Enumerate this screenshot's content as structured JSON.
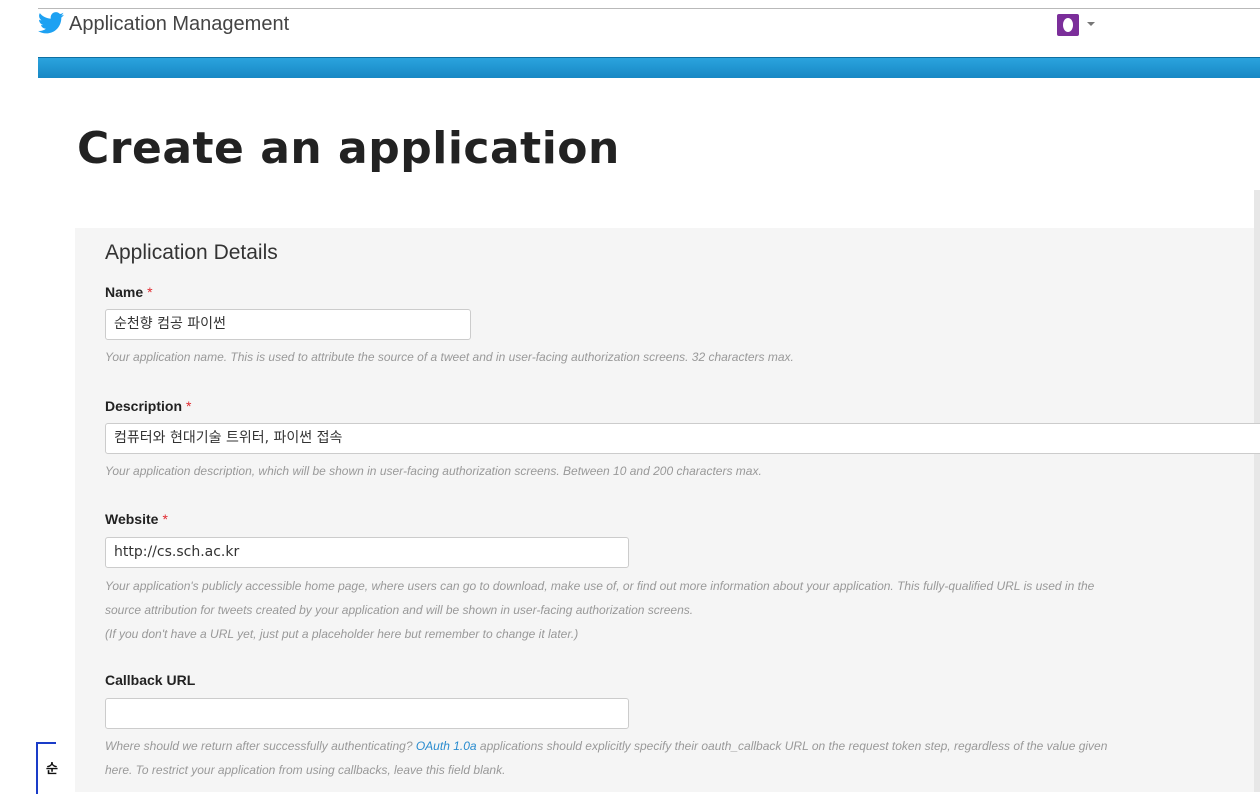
{
  "header": {
    "app_title": "Application Management",
    "logo_icon": "twitter-bird-icon",
    "brand_color": "#1da1f2",
    "avatar_icon": "user-avatar-icon",
    "menu_icon": "caret-down-icon"
  },
  "page": {
    "title": "Create an application"
  },
  "form": {
    "section_title": "Application Details",
    "required_marker": "*",
    "name": {
      "label": "Name",
      "value": "순천향 컴공 파이썬",
      "help": "Your application name. This is used to attribute the source of a tweet and in user-facing authorization screens. 32 characters max."
    },
    "description": {
      "label": "Description",
      "value": "컴퓨터와 현대기술 트위터, 파이썬 접속",
      "help": "Your application description, which will be shown in user-facing authorization screens. Between 10 and 200 characters max."
    },
    "website": {
      "label": "Website",
      "value": "http://cs.sch.ac.kr",
      "help_line1": "Your application's publicly accessible home page, where users can go to download, make use of, or find out more information about your application. This fully-qualified URL is used in the",
      "help_line2": "source attribution for tweets created by your application and will be shown in user-facing authorization screens.",
      "help_line3": "(If you don't have a URL yet, just put a placeholder here but remember to change it later.)"
    },
    "callback": {
      "label": "Callback URL",
      "value": "",
      "help_prefix": "Where should we return after successfully authenticating?",
      "help_link": "OAuth 1.0a",
      "help_suffix": "applications should explicitly specify their oauth_callback URL on the request token step, regardless of the value given",
      "help_line2": "here. To restrict your application from using callbacks, leave this field blank."
    }
  },
  "side_tab": {
    "label": "순"
  }
}
